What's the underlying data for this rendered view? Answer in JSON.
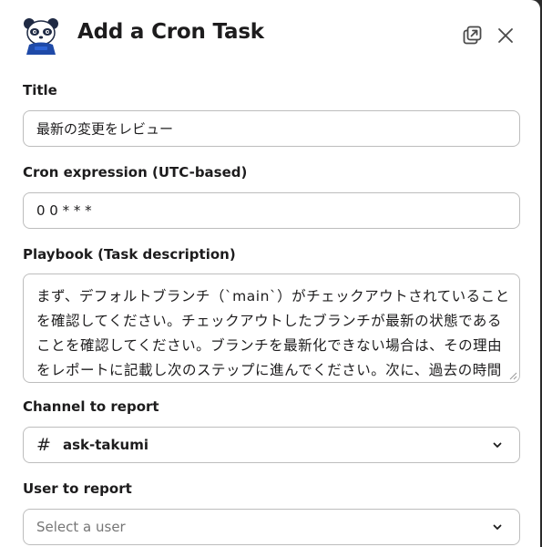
{
  "modal": {
    "title": "Add a Cron Task"
  },
  "header": {
    "logo_icon": "panda-icon",
    "popout_icon": "popout-icon",
    "close_icon": "close-icon"
  },
  "form": {
    "title_label": "Title",
    "title_value": "最新の変更をレビュー",
    "cron_label": "Cron expression (UTC-based)",
    "cron_value": "0 0 * * *",
    "playbook_label": "Playbook (Task description)",
    "playbook_value": "まず、デフォルトブランチ（`main`）がチェックアウトされていることを確認してください。チェックアウトしたブランチが最新の状態であることを確認してください。ブランチを最新化できない場合は、その理由をレポートに記載し次のステップに進んでください。次に、過去の時間以内に行われたコミットを対象として、リリース",
    "channel_label": "Channel to report",
    "channel_value": "ask-takumi",
    "user_label": "User to report",
    "user_placeholder": "Select a user"
  }
}
